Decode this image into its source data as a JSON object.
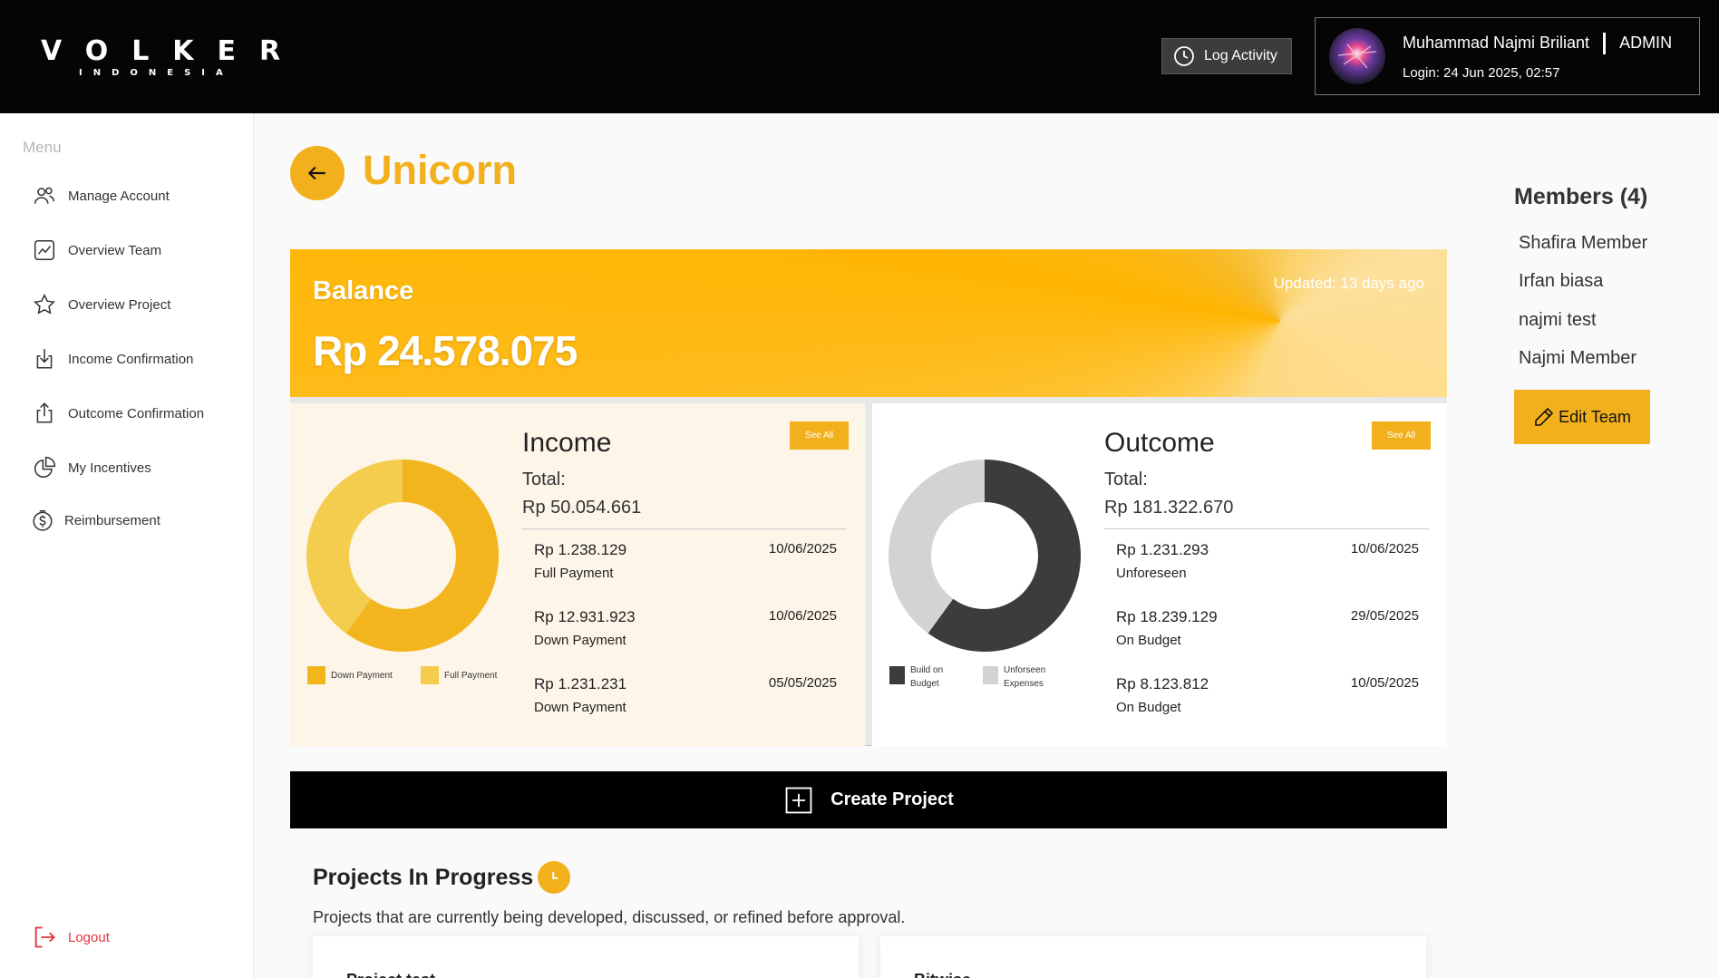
{
  "brand": {
    "name": "VOLKER",
    "subtitle": "INDONESIA"
  },
  "header": {
    "log_activity_label": "Log Activity",
    "user_name": "Muhammad Najmi Briliant",
    "role": "ADMIN",
    "login_text": "Login: 24 Jun 2025, 02:57"
  },
  "sidebar": {
    "title": "Menu",
    "items": [
      {
        "label": "Manage Account",
        "icon": "users-icon"
      },
      {
        "label": "Overview Team",
        "icon": "chart-line-icon"
      },
      {
        "label": "Overview Project",
        "icon": "star-icon"
      },
      {
        "label": "Income Confirmation",
        "icon": "download-icon"
      },
      {
        "label": "Outcome Confirmation",
        "icon": "upload-icon"
      },
      {
        "label": "My Incentives",
        "icon": "pie-chart-icon"
      },
      {
        "label": "Reimbursement",
        "icon": "dollar-circle-icon"
      }
    ],
    "logout_label": "Logout"
  },
  "page": {
    "title": "Unicorn"
  },
  "balance": {
    "label": "Balance",
    "value": "Rp 24.578.075",
    "updated": "Updated: 13 days ago"
  },
  "income": {
    "title": "Income",
    "see_all": "See All",
    "total_label": "Total:",
    "total_value": "Rp 50.054.661",
    "chart_data": {
      "type": "pie",
      "categories": [
        "Down Payment",
        "Full Payment"
      ],
      "values": [
        60,
        40
      ],
      "colors": [
        "#f2b51e",
        "#f5cd4e"
      ]
    },
    "legend": [
      "Down Payment",
      "Full Payment"
    ],
    "transactions": [
      {
        "amount": "Rp 1.238.129",
        "type": "Full Payment",
        "date": "10/06/2025"
      },
      {
        "amount": "Rp 12.931.923",
        "type": "Down Payment",
        "date": "10/06/2025"
      },
      {
        "amount": "Rp 1.231.231",
        "type": "Down Payment",
        "date": "05/05/2025"
      }
    ]
  },
  "outcome": {
    "title": "Outcome",
    "see_all": "See All",
    "total_label": "Total:",
    "total_value": "Rp 181.322.670",
    "chart_data": {
      "type": "pie",
      "categories": [
        "Build on Budget",
        "Unforseen Expenses"
      ],
      "values": [
        60,
        40
      ],
      "colors": [
        "#3c3c3c",
        "#d3d3d3"
      ]
    },
    "legend": [
      {
        "line1": "Build on",
        "line2": "Budget"
      },
      {
        "line1": "Unforseen",
        "line2": "Expenses"
      }
    ],
    "transactions": [
      {
        "amount": "Rp 1.231.293",
        "type": "Unforeseen",
        "date": "10/06/2025"
      },
      {
        "amount": "Rp 18.239.129",
        "type": "On Budget",
        "date": "29/05/2025"
      },
      {
        "amount": "Rp 8.123.812",
        "type": "On Budget",
        "date": "10/05/2025"
      }
    ]
  },
  "create_project_label": "Create Project",
  "projects": {
    "title": "Projects In Progress",
    "description": "Projects that are currently being developed, discussed, or refined before approval.",
    "cards": [
      {
        "title": "Project test"
      },
      {
        "title": "Bitwise"
      }
    ]
  },
  "members": {
    "title": "Members (4)",
    "list": [
      "Shafira Member",
      "Irfan biasa",
      "najmi test",
      "Najmi Member"
    ],
    "edit_label": "Edit Team"
  },
  "colors": {
    "accent": "#f2b01d",
    "header_bg": "#050505",
    "logout": "#e0343c"
  }
}
